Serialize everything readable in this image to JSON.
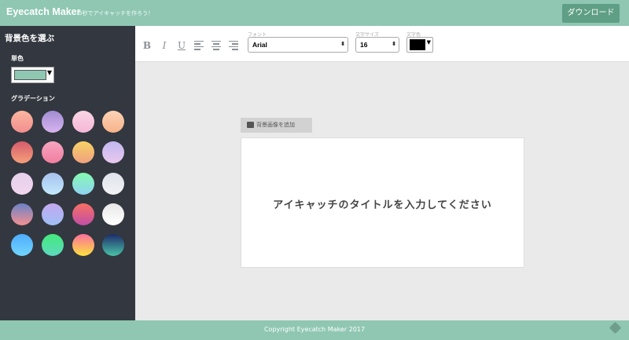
{
  "header": {
    "brand": "Eyecatch Maker",
    "tagline": "5秒でアイキャッチを作ろう！",
    "download_label": "ダウンロード"
  },
  "sidebar": {
    "title": "背景色を選ぶ",
    "solid_label": "単色",
    "solid_color": "#8fc7b3",
    "gradient_label": "グラデーション",
    "gradients": [
      [
        "#fcb69f",
        "#f28e8e"
      ],
      [
        "#a18cd1",
        "#d8b4f0"
      ],
      [
        "#f9d5e5",
        "#f5b7d6"
      ],
      [
        "#fcd3b6",
        "#f7b38a"
      ],
      [
        "#d65b6c",
        "#f5a07a"
      ],
      [
        "#f6a5c0",
        "#f17ea0"
      ],
      [
        "#f6d365",
        "#f0a080"
      ],
      [
        "#c2b8f0",
        "#e8c8ee"
      ],
      [
        "#e5d0ec",
        "#f2d6ee"
      ],
      [
        "#a6c1ee",
        "#c2e9fb"
      ],
      [
        "#84fab0",
        "#8fd3f4"
      ],
      [
        "#dfe3ea",
        "#f1f2f5"
      ],
      [
        "#6a82c8",
        "#f49090"
      ],
      [
        "#c3a8f0",
        "#9fbff5"
      ],
      [
        "#f77062",
        "#c24ea8"
      ],
      [
        "#e8e8e8",
        "#ffffff"
      ],
      [
        "#4facfe",
        "#71d6fd"
      ],
      [
        "#43e97b",
        "#5ed9c0"
      ],
      [
        "#fa709a",
        "#fee140"
      ],
      [
        "#1e2a6a",
        "#49c3a6"
      ]
    ]
  },
  "toolbar": {
    "bold": "B",
    "italic": "I",
    "underline": "U",
    "font_label": "フォント",
    "font_value": "Arial",
    "size_label": "文字サイズ",
    "size_value": "16",
    "color_label": "文字色",
    "text_color": "#000000"
  },
  "canvas": {
    "add_bg_label": "背景画像を追加",
    "title": "アイキャッチのタイトルを入力してください"
  },
  "footer": {
    "copyright": "Copyright Eyecatch Maker 2017"
  }
}
